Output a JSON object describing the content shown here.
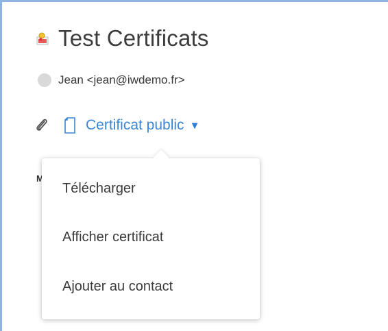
{
  "message": {
    "subject": "Test Certificats",
    "subject_icon": "certificate-icon",
    "sender": "Jean <jean@iwdemo.fr>"
  },
  "attachment": {
    "clip_icon": "paperclip-icon",
    "file_icon": "document-icon",
    "label": "Certificat public",
    "caret": "▼"
  },
  "hidden_text": {
    "cut_letter": "M"
  },
  "menu": {
    "items": [
      {
        "label": "Télécharger"
      },
      {
        "label": "Afficher certificat"
      },
      {
        "label": "Ajouter au contact"
      }
    ]
  },
  "colors": {
    "link": "#3b87d4",
    "border": "#8fb3e3",
    "avatar": "#d9d9d9"
  }
}
